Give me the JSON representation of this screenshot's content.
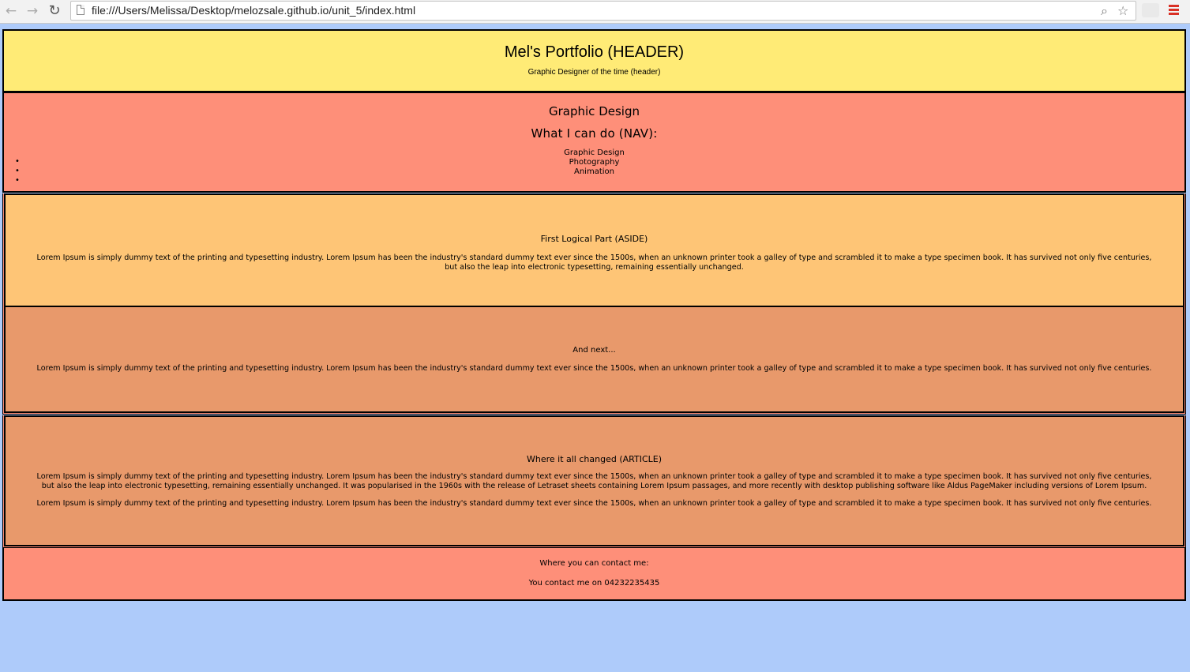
{
  "browser": {
    "url": "file:///Users/Melissa/Desktop/melozsale.github.io/unit_5/index.html"
  },
  "header": {
    "title": "Mel's Portfolio (HEADER)",
    "subtitle": "Graphic Designer of the time (header)"
  },
  "nav": {
    "title": "Graphic Design",
    "subtitle": "What I can do (NAV):",
    "items": [
      "Graphic Design",
      "Photography",
      "Animation"
    ]
  },
  "aside": {
    "heading": "First Logical Part (ASIDE)",
    "text": "Lorem Ipsum is simply dummy text of the printing and typesetting industry. Lorem Ipsum has been the industry's standard dummy text ever since the 1500s, when an unknown printer took a galley of type and scrambled it to make a type specimen book. It has survived not only five centuries, but also the leap into electronic typesetting, remaining essentially unchanged."
  },
  "next": {
    "heading": "And next...",
    "text": "Lorem Ipsum is simply dummy text of the printing and typesetting industry. Lorem Ipsum has been the industry's standard dummy text ever since the 1500s, when an unknown printer took a galley of type and scrambled it to make a type specimen book. It has survived not only five centuries."
  },
  "article": {
    "heading": "Where it all changed (ARTICLE)",
    "paragraph1": "Lorem Ipsum is simply dummy text of the printing and typesetting industry. Lorem Ipsum has been the industry's standard dummy text ever since the 1500s, when an unknown printer took a galley of type and scrambled it to make a type specimen book. It has survived not only five centuries, but also the leap into electronic typesetting, remaining essentially unchanged. It was popularised in the 1960s with the release of Letraset sheets containing Lorem Ipsum passages, and more recently with desktop publishing software like Aldus PageMaker including versions of Lorem Ipsum.",
    "paragraph2": "Lorem Ipsum is simply dummy text of the printing and typesetting industry. Lorem Ipsum has been the industry's standard dummy text ever since the 1500s, when an unknown printer took a galley of type and scrambled it to make a type specimen book. It has survived not only five centuries."
  },
  "footer": {
    "heading": "Where you can contact me:",
    "contact": "You contact me on 04232235435"
  },
  "colors": {
    "page_background": "#aecbfa",
    "header": "#ffeb76",
    "nav": "#fe8f79",
    "aside": "#fec576",
    "article": "#e8996b",
    "footer": "#fe8f79",
    "menu_icon": "#d93025"
  }
}
